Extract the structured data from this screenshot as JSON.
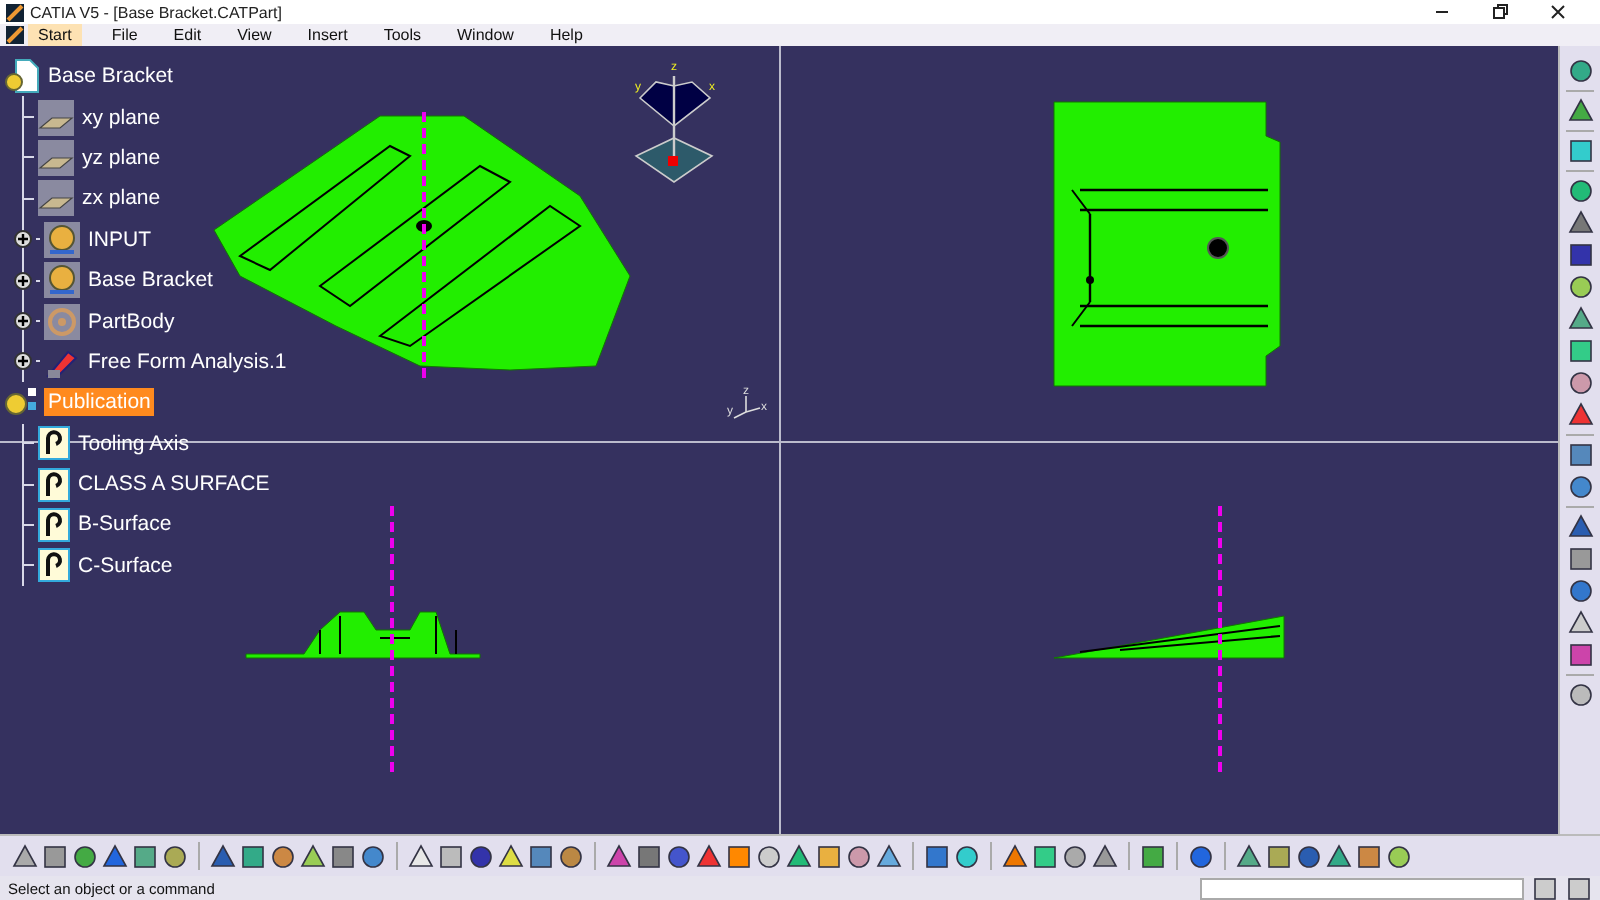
{
  "window": {
    "title": "CATIA V5 - [Base Bracket.CATPart]"
  },
  "menu": [
    {
      "label": "Start",
      "selected": true
    },
    {
      "label": "File",
      "selected": false
    },
    {
      "label": "Edit",
      "selected": false
    },
    {
      "label": "View",
      "selected": false
    },
    {
      "label": "Insert",
      "selected": false
    },
    {
      "label": "Tools",
      "selected": false
    },
    {
      "label": "Window",
      "selected": false
    },
    {
      "label": "Help",
      "selected": false
    }
  ],
  "tree": [
    {
      "label": "Base Bracket",
      "kind": "part",
      "selected": false,
      "expandable": false,
      "children": [
        {
          "label": "xy plane",
          "kind": "plane",
          "selected": false,
          "expandable": false
        },
        {
          "label": "yz plane",
          "kind": "plane",
          "selected": false,
          "expandable": false
        },
        {
          "label": "zx plane",
          "kind": "plane",
          "selected": false,
          "expandable": false
        },
        {
          "label": "INPUT",
          "kind": "set",
          "selected": false,
          "expandable": true
        },
        {
          "label": "Base Bracket",
          "kind": "set",
          "selected": false,
          "expandable": true
        },
        {
          "label": "PartBody",
          "kind": "body",
          "selected": false,
          "expandable": true
        },
        {
          "label": "Free Form Analysis.1",
          "kind": "analysis",
          "selected": false,
          "expandable": true
        }
      ]
    },
    {
      "label": "Publication",
      "kind": "publication",
      "selected": true,
      "expandable": false,
      "children": [
        {
          "label": "Tooling Axis",
          "kind": "published",
          "selected": false,
          "expandable": false
        },
        {
          "label": "CLASS A SURFACE",
          "kind": "published",
          "selected": false,
          "expandable": false
        },
        {
          "label": "B-Surface",
          "kind": "published",
          "selected": false,
          "expandable": false
        },
        {
          "label": "C-Surface",
          "kind": "published",
          "selected": false,
          "expandable": false
        }
      ]
    }
  ],
  "compass": {
    "axes": [
      "z",
      "y",
      "x"
    ]
  },
  "axis_triad": {
    "axes": [
      "z",
      "y",
      "x"
    ]
  },
  "status_bar": {
    "message": "Select an object or a command"
  }
}
